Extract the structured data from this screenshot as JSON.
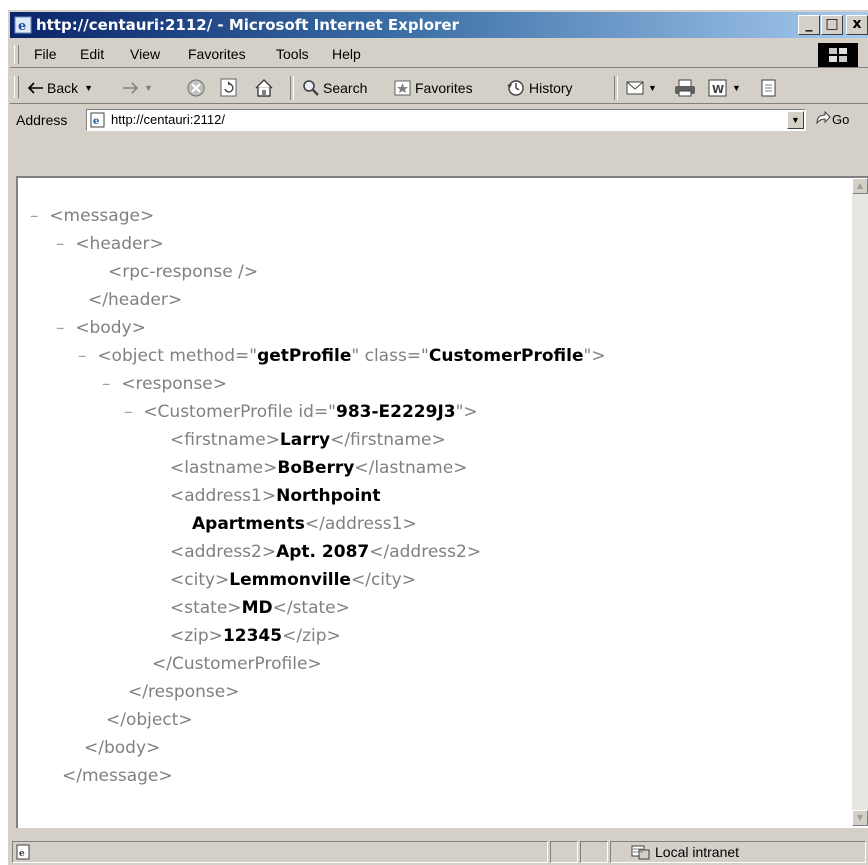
{
  "window": {
    "title": "http://centauri:2112/ - Microsoft Internet Explorer",
    "minimize": "_",
    "maximize": "□",
    "close": "x"
  },
  "menu": {
    "file": "File",
    "edit": "Edit",
    "view": "View",
    "favorites": "Favorites",
    "tools": "Tools",
    "help": "Help"
  },
  "toolbar": {
    "back": "Back",
    "search": "Search",
    "favorites": "Favorites",
    "history": "History"
  },
  "address": {
    "label": "Address",
    "url": "http://centauri:2112/",
    "go": "Go"
  },
  "xml": {
    "minus": "–",
    "lines": {
      "message_open": "<message>",
      "header_open": "<header>",
      "rpc_response": "<rpc-response />",
      "header_close": "</header>",
      "body_open": "<body>",
      "object_start": "<object method=\"",
      "object_method": "getProfile",
      "object_mid": "\" class=\"",
      "object_class": "CustomerProfile",
      "object_end": "\">",
      "response_open": "<response>",
      "cp_start": "<CustomerProfile id=\"",
      "cp_id": "983-E2229J3",
      "cp_end": "\">",
      "firstname_open": "<firstname>",
      "firstname_value": "Larry",
      "firstname_close": "</firstname>",
      "lastname_open": "<lastname>",
      "lastname_value": "BoBerry",
      "lastname_close": "</lastname>",
      "address1_open": "<address1>",
      "address1_value_1": "Northpoint",
      "address1_value_2": "Apartments",
      "address1_close": "</address1>",
      "address2_open": "<address2>",
      "address2_value": "Apt. 2087",
      "address2_close": "</address2>",
      "city_open": "<city>",
      "city_value": "Lemmonville",
      "city_close": "</city>",
      "state_open": "<state>",
      "state_value": "MD",
      "state_close": "</state>",
      "zip_open": "<zip>",
      "zip_value": "12345",
      "zip_close": "</zip>",
      "cp_close": "</CustomerProfile>",
      "response_close": "</response>",
      "object_close": "</object>",
      "body_close": "</body>",
      "message_close": "</message>"
    }
  },
  "status": {
    "zone": "Local intranet"
  }
}
